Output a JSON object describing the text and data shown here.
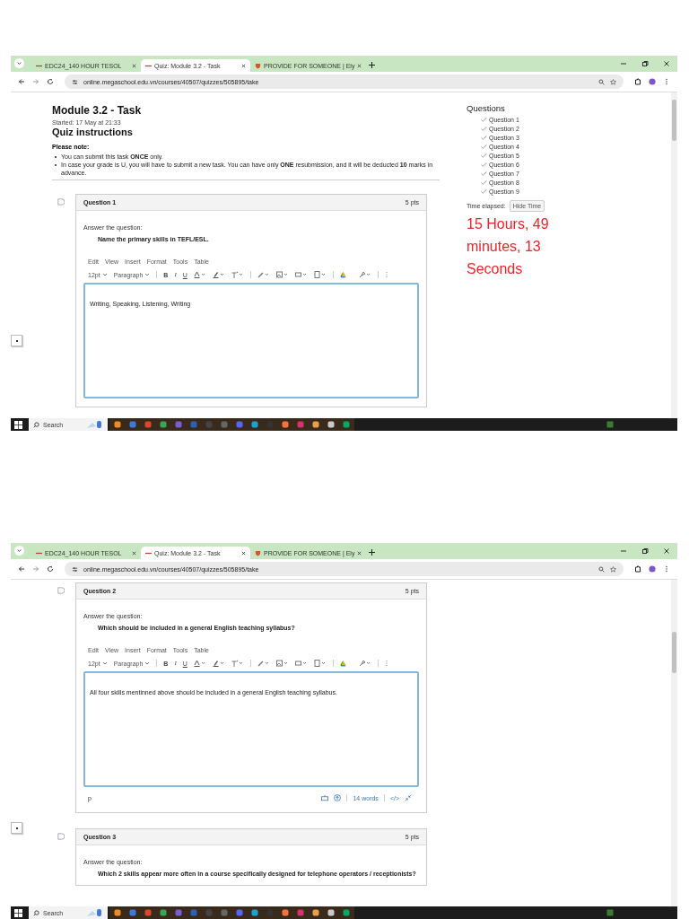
{
  "screenshots": [
    {
      "browser": {
        "tabs": [
          {
            "title": "EDC24_140 HOUR TESOL",
            "selected": false
          },
          {
            "title": "Quiz: Module 3.2 - Task",
            "selected": true
          },
          {
            "title": "PROVIDE FOR SOMEONE | Ely",
            "selected": false
          }
        ],
        "url": "online.megaschool.edu.vn/courses/40507/quizzes/505895/take"
      },
      "header": {
        "title": "Module 3.2 - Task",
        "started": "Started: 17 May at 21:33",
        "instructions_title": "Quiz instructions",
        "note_label": "Please note:",
        "notes": [
          "You can submit this task **ONCE** only.",
          "In case your grade is U, you will have to submit a new task. You can have only **ONE** resubmission, and it will be deducted **10** marks in advance."
        ]
      },
      "questions": [
        {
          "title": "Question 1",
          "points": "5 pts",
          "prompt": "Answer the question:",
          "question": "Name the primary skills in TEFL/ESL.",
          "editor": {
            "menu": [
              "Edit",
              "View",
              "Insert",
              "Format",
              "Tools",
              "Table"
            ],
            "font_size": "12pt",
            "block_format": "Paragraph",
            "format_buttons": [
              "B",
              "I",
              "U"
            ],
            "answer": "Writing, Speaking, Listening, Writing"
          }
        }
      ],
      "sidebar": {
        "title": "Questions",
        "questions": [
          {
            "label": "Question 1",
            "answered": true
          },
          {
            "label": "Question 2",
            "answered": true
          },
          {
            "label": "Question 3",
            "answered": true
          },
          {
            "label": "Question 4",
            "answered": true
          },
          {
            "label": "Question 5",
            "answered": true
          },
          {
            "label": "Question 6",
            "answered": true
          },
          {
            "label": "Question 7",
            "answered": true
          },
          {
            "label": "Question 8",
            "answered": true
          },
          {
            "label": "Question 9",
            "answered": true
          }
        ],
        "time_label": "Time elapsed:",
        "hide_button": "Hide Time",
        "timer": "15 Hours, 49 minutes, 13 Seconds"
      },
      "taskbar": {
        "search": "Search"
      }
    },
    {
      "browser": {
        "tabs": [
          {
            "title": "EDC24_140 HOUR TESOL",
            "selected": false
          },
          {
            "title": "Quiz: Module 3.2 - Task",
            "selected": true
          },
          {
            "title": "PROVIDE FOR SOMEONE | Ely",
            "selected": false
          }
        ],
        "url": "online.megaschool.edu.vn/courses/40507/quizzes/505895/take"
      },
      "questions": [
        {
          "title": "Question 2",
          "points": "5 pts",
          "prompt": "Answer the question:",
          "question": "Which should be included in a general English teaching syllabus?",
          "editor": {
            "menu": [
              "Edit",
              "View",
              "Insert",
              "Format",
              "Tools",
              "Table"
            ],
            "font_size": "12pt",
            "block_format": "Paragraph",
            "format_buttons": [
              "B",
              "I",
              "U"
            ],
            "answer": "All four skills mentinned above should be included in a general English teaching syllabus.",
            "footer": {
              "element": "p",
              "word_count": "14 words",
              "html_toggle": "</>"
            }
          }
        },
        {
          "title": "Question 3",
          "points": "5 pts",
          "prompt": "Answer the question:",
          "question": "Which 2 skills appear more often in a course specifically designed for telephone operators / receptionists?"
        }
      ],
      "taskbar": {
        "search": "Search"
      }
    }
  ]
}
